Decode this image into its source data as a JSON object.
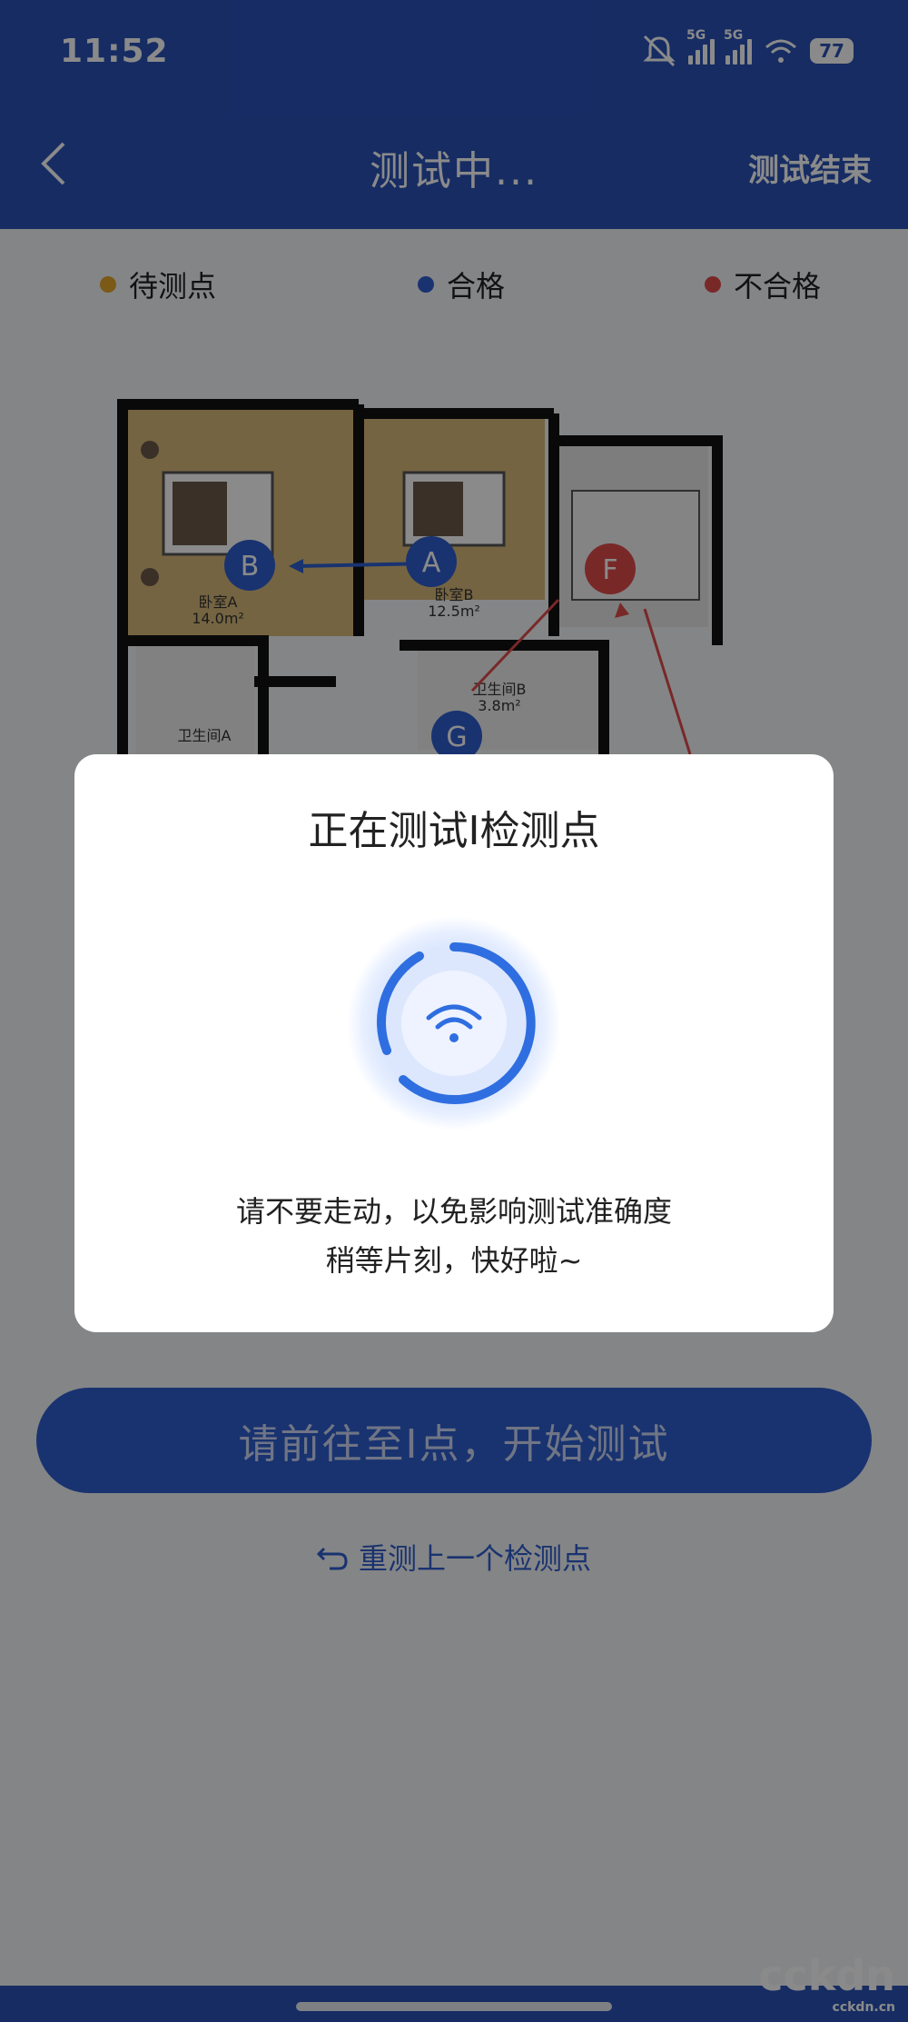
{
  "status_bar": {
    "time": "11:52",
    "network1": "5G",
    "network2": "5G",
    "battery": "77"
  },
  "header": {
    "title": "测试中...",
    "end_label": "测试结束"
  },
  "legend": {
    "items": [
      {
        "label": "待测点",
        "color": "#e3a52b"
      },
      {
        "label": "合格",
        "color": "#2f5fd0"
      },
      {
        "label": "不合格",
        "color": "#e04a4a"
      }
    ]
  },
  "floorplan": {
    "rooms": [
      {
        "name": "卧室A",
        "area": "14.0m²"
      },
      {
        "name": "卧室B",
        "area": "12.5m²"
      },
      {
        "name": "卫生间B",
        "area": "3.8m²"
      },
      {
        "name": "卫生间A"
      }
    ],
    "points": [
      {
        "label": "A",
        "status": "pass"
      },
      {
        "label": "B",
        "status": "pass"
      },
      {
        "label": "F",
        "status": "fail"
      },
      {
        "label": "G",
        "status": "pass"
      }
    ]
  },
  "dialog": {
    "title": "正在测试I检测点",
    "message_line1": "请不要走动，以免影响测试准确度",
    "message_line2": "稍等片刻，快好啦~"
  },
  "actions": {
    "start_button": "请前往至I点，开始测试",
    "retest_link": "重测上一个检测点"
  },
  "watermark": {
    "main": "cckdn",
    "sub": "cckdn.cn"
  },
  "colors": {
    "primary": "#2a52b8",
    "accent": "#2f5fd0",
    "fail": "#e04a4a",
    "pending": "#e3a52b"
  }
}
